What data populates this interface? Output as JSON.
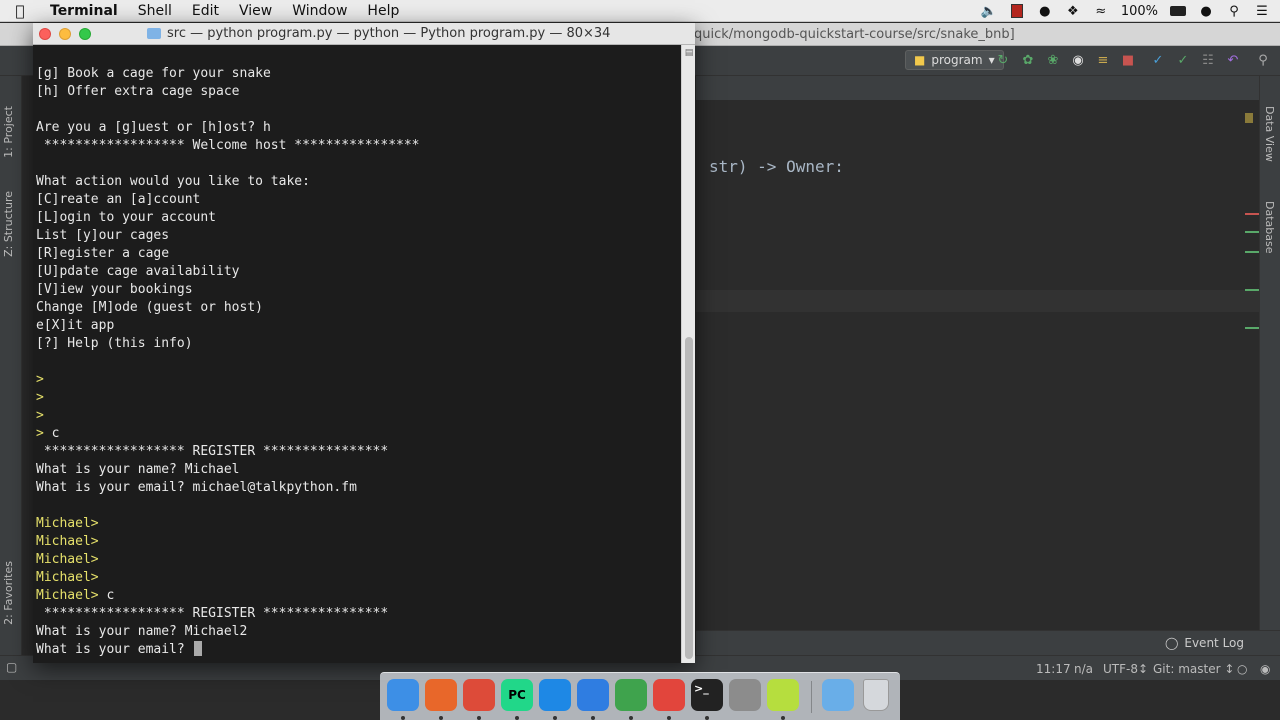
{
  "menubar": {
    "app_name": "Terminal",
    "items": [
      "Shell",
      "Edit",
      "View",
      "Window",
      "Help"
    ],
    "battery": "100%"
  },
  "ide": {
    "title_path": "quick/mongodb-quickstart-course/src/snake_bnb]",
    "run_config": "program",
    "code_fragment": "str) -> Owner:",
    "left_tabs": [
      "1: Project",
      "Z: Structure",
      "2: Favorites"
    ],
    "right_tabs": [
      "Data View",
      "Database"
    ],
    "event_log": "Event Log",
    "status": {
      "position": "11:17",
      "na": "n/a",
      "encoding": "UTF-8↕",
      "git": "Git: master ↕"
    }
  },
  "terminal": {
    "title": "src — python program.py — python — Python program.py — 80×34",
    "lines": [
      {
        "text": "[g] Book a cage for your snake"
      },
      {
        "text": "[h] Offer extra cage space"
      },
      {
        "text": ""
      },
      {
        "text": "Are you a [g]uest or [h]ost? h"
      },
      {
        "text": " ****************** Welcome host ****************"
      },
      {
        "text": ""
      },
      {
        "text": "What action would you like to take:"
      },
      {
        "text": "[C]reate an [a]ccount"
      },
      {
        "text": "[L]ogin to your account"
      },
      {
        "text": "List [y]our cages"
      },
      {
        "text": "[R]egister a cage"
      },
      {
        "text": "[U]pdate cage availability"
      },
      {
        "text": "[V]iew your bookings"
      },
      {
        "text": "Change [M]ode (guest or host)"
      },
      {
        "text": "e[X]it app"
      },
      {
        "text": "[?] Help (this info)"
      },
      {
        "text": ""
      },
      {
        "prompt": ">",
        "text": ""
      },
      {
        "prompt": ">",
        "text": ""
      },
      {
        "prompt": ">",
        "text": ""
      },
      {
        "prompt": ">",
        "text": " c"
      },
      {
        "text": " ****************** REGISTER ****************"
      },
      {
        "text": "What is your name? Michael"
      },
      {
        "text": "What is your email? michael@talkpython.fm"
      },
      {
        "text": ""
      },
      {
        "prompt": "Michael>",
        "text": ""
      },
      {
        "prompt": "Michael>",
        "text": ""
      },
      {
        "prompt": "Michael>",
        "text": ""
      },
      {
        "prompt": "Michael>",
        "text": ""
      },
      {
        "prompt": "Michael>",
        "text": " c"
      },
      {
        "text": " ****************** REGISTER ****************"
      },
      {
        "text": "What is your name? Michael2"
      },
      {
        "text": "What is your email? ",
        "cursor": true
      }
    ]
  },
  "dock": {
    "items": [
      {
        "name": "finder-icon",
        "label": "",
        "color": "#3d8fe6"
      },
      {
        "name": "firefox-icon",
        "label": "",
        "color": "#e8672a"
      },
      {
        "name": "chrome-icon",
        "label": "",
        "color": "#dd4b39"
      },
      {
        "name": "pycharm-icon",
        "label": "PC",
        "color": "#21d789"
      },
      {
        "name": "vscode-icon",
        "label": "",
        "color": "#1e88e5"
      },
      {
        "name": "maps-icon",
        "label": "",
        "color": "#2f7de1"
      },
      {
        "name": "robomongo-icon",
        "label": "",
        "color": "#3fa34d"
      },
      {
        "name": "pen-icon",
        "label": "",
        "color": "#e2453c"
      },
      {
        "name": "terminal-icon",
        "label": ">_",
        "color": "#222222"
      },
      {
        "name": "system-preferences-icon",
        "label": "",
        "color": "#8c8c8c"
      },
      {
        "name": "notes-icon",
        "label": "",
        "color": "#b6de3e"
      },
      {
        "name": "downloads-folder-icon",
        "label": "",
        "color": "#69aee8"
      },
      {
        "name": "trash-icon",
        "label": "",
        "color": "#d5d8dc"
      }
    ]
  },
  "colors": {
    "prompt": "#e5e06a",
    "terminal_bg": "#1c1c1c",
    "ide_bg": "#2b2b2b"
  }
}
